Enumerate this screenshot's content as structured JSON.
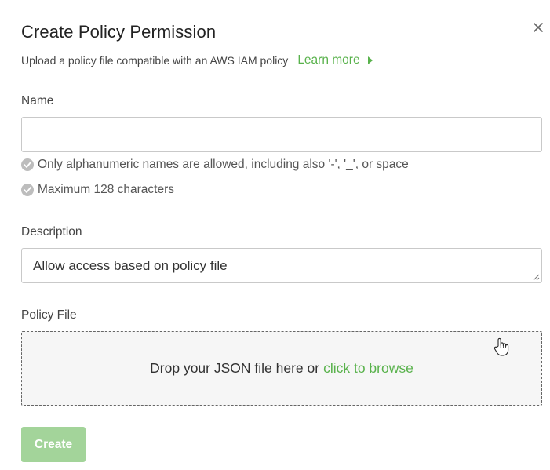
{
  "dialog": {
    "title": "Create Policy Permission",
    "subtitle": "Upload a policy file compatible with an AWS IAM policy",
    "learn_more_label": "Learn more",
    "close_icon": "close-icon"
  },
  "name_field": {
    "label": "Name",
    "value": "",
    "placeholder": "",
    "rules": [
      "Only alphanumeric names are allowed, including also '-', '_', or space",
      "Maximum 128 characters"
    ]
  },
  "description_field": {
    "label": "Description",
    "value": "Allow access based on policy file"
  },
  "policy_file": {
    "label": "Policy File",
    "drop_text": "Drop your JSON file here or",
    "browse_label": "click to browse"
  },
  "actions": {
    "create_label": "Create"
  },
  "colors": {
    "accent": "#59b24c",
    "button_disabled": "#a3d49a",
    "rule_check": "#bdbdbd"
  }
}
